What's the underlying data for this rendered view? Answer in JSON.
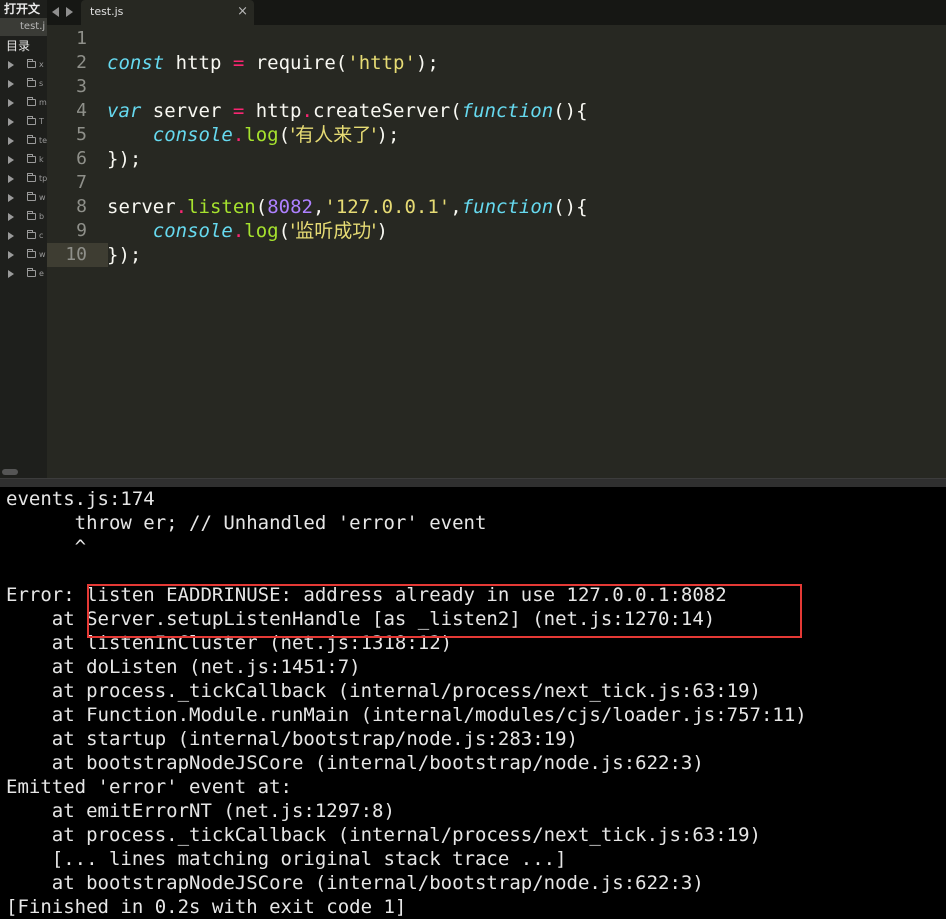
{
  "sidebar": {
    "open_files_title": "打开文",
    "open_file": "test.j",
    "folders_title": "目录",
    "folders": [
      "x",
      "s",
      "m",
      "T",
      "te",
      "k",
      "tp",
      "w",
      "b",
      "c",
      "w",
      "e"
    ]
  },
  "tabs": [
    {
      "label": "test.js",
      "close": "×"
    }
  ],
  "editor": {
    "current_line": 10,
    "lines": [
      {
        "n": "1",
        "tokens": []
      },
      {
        "n": "2",
        "tokens": [
          [
            "kw",
            "const"
          ],
          [
            "plain",
            " http "
          ],
          [
            "op",
            "="
          ],
          [
            "plain",
            " require("
          ],
          [
            "str",
            "'http'"
          ],
          [
            "plain",
            ");"
          ]
        ]
      },
      {
        "n": "3",
        "tokens": []
      },
      {
        "n": "4",
        "tokens": [
          [
            "kw",
            "var"
          ],
          [
            "plain",
            " server "
          ],
          [
            "op",
            "="
          ],
          [
            "plain",
            " http"
          ],
          [
            "op",
            "."
          ],
          [
            "plain",
            "createServer("
          ],
          [
            "kw",
            "function"
          ],
          [
            "plain",
            "(){"
          ]
        ]
      },
      {
        "n": "5",
        "tokens": [
          [
            "plain",
            "    "
          ],
          [
            "kw",
            "console"
          ],
          [
            "op",
            "."
          ],
          [
            "fn",
            "log"
          ],
          [
            "plain",
            "("
          ],
          [
            "str",
            "'有人来了'"
          ],
          [
            "plain",
            ");"
          ]
        ]
      },
      {
        "n": "6",
        "tokens": [
          [
            "plain",
            "});"
          ]
        ]
      },
      {
        "n": "7",
        "tokens": []
      },
      {
        "n": "8",
        "tokens": [
          [
            "plain",
            "server"
          ],
          [
            "op",
            "."
          ],
          [
            "fn",
            "listen"
          ],
          [
            "plain",
            "("
          ],
          [
            "num",
            "8082"
          ],
          [
            "plain",
            ","
          ],
          [
            "str",
            "'127.0.0.1'"
          ],
          [
            "plain",
            ","
          ],
          [
            "kw",
            "function"
          ],
          [
            "plain",
            "(){"
          ]
        ]
      },
      {
        "n": "9",
        "tokens": [
          [
            "plain",
            "    "
          ],
          [
            "kw",
            "console"
          ],
          [
            "op",
            "."
          ],
          [
            "fn",
            "log"
          ],
          [
            "plain",
            "("
          ],
          [
            "str",
            "'监听成功'"
          ],
          [
            "plain",
            ")"
          ]
        ]
      },
      {
        "n": "10",
        "tokens": [
          [
            "plain",
            "});"
          ]
        ]
      }
    ]
  },
  "console": {
    "lines": [
      "events.js:174",
      "      throw er; // Unhandled 'error' event",
      "      ^",
      "",
      "Error: listen EADDRINUSE: address already in use 127.0.0.1:8082",
      "    at Server.setupListenHandle [as _listen2] (net.js:1270:14)",
      "    at listenInCluster (net.js:1318:12)",
      "    at doListen (net.js:1451:7)",
      "    at process._tickCallback (internal/process/next_tick.js:63:19)",
      "    at Function.Module.runMain (internal/modules/cjs/loader.js:757:11)",
      "    at startup (internal/bootstrap/node.js:283:19)",
      "    at bootstrapNodeJSCore (internal/bootstrap/node.js:622:3)",
      "Emitted 'error' event at:",
      "    at emitErrorNT (net.js:1297:8)",
      "    at process._tickCallback (internal/process/next_tick.js:63:19)",
      "    [... lines matching original stack trace ...]",
      "    at bootstrapNodeJSCore (internal/bootstrap/node.js:622:3)",
      "[Finished in 0.2s with exit code 1]"
    ]
  },
  "colors": {
    "editor_bg": "#272822",
    "keyword": "#66d9ef",
    "operator": "#f92672",
    "function": "#a6e22e",
    "string": "#e6db74",
    "number": "#ae81ff",
    "highlight_box": "#e53935"
  }
}
